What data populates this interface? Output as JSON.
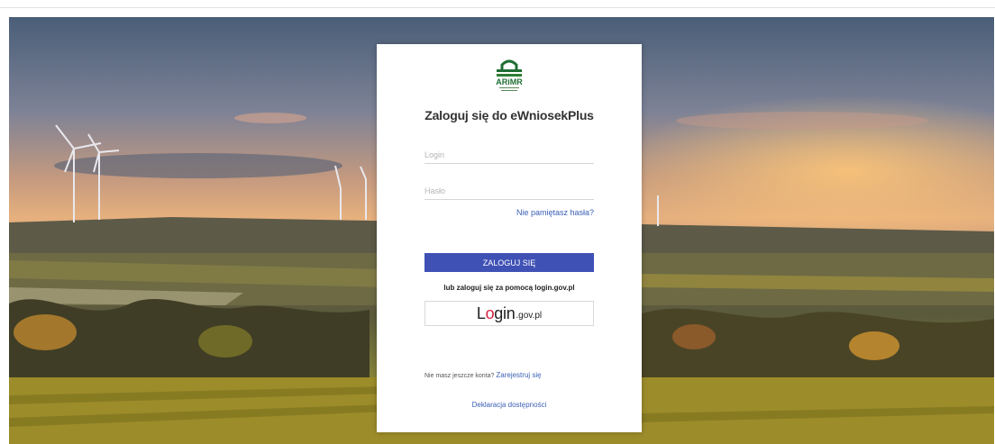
{
  "brand": {
    "logo_text": "ARiMR",
    "accent": "#2e7d32",
    "primary": "#3f51b5",
    "link": "#3a5fb5"
  },
  "login": {
    "title": "Zaloguj się do eWniosekPlus",
    "login_placeholder": "Login",
    "password_placeholder": "Hasło",
    "forgot_label": "Nie pamiętasz hasła?",
    "submit_label": "ZALOGUJ SIĘ",
    "alt_text": "lub zaloguj się za pomocą login.gov.pl",
    "gov_l": "L",
    "gov_o": "o",
    "gov_rest": "gin",
    "gov_suffix": ".gov.pl",
    "no_account": "Nie masz jeszcze konta?",
    "register_label": "Zarejestruj się",
    "declaration_label": "Deklaracja dostępności"
  }
}
